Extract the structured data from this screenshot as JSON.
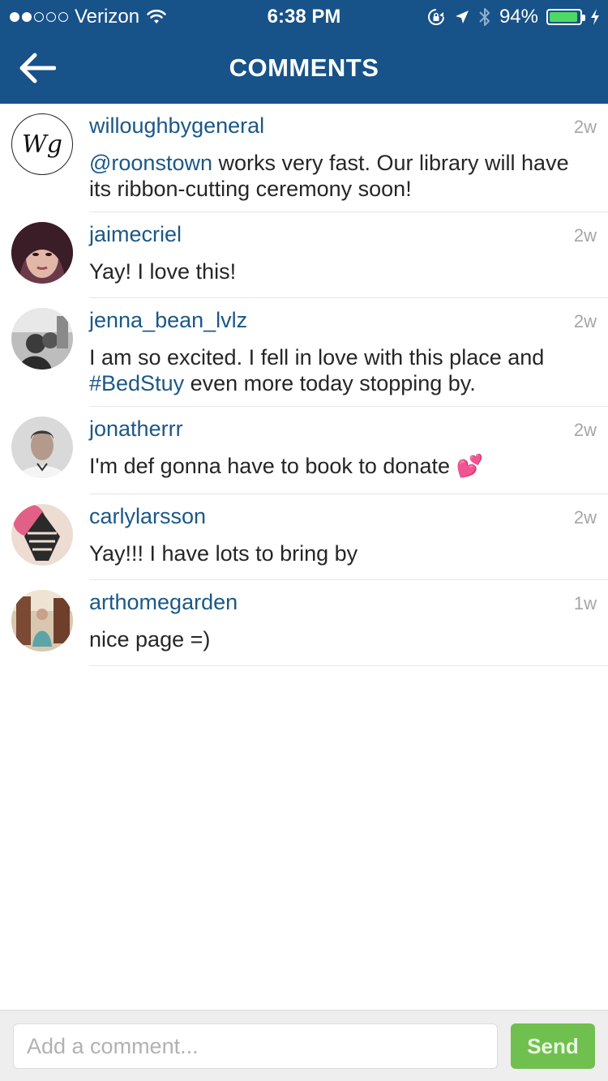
{
  "status_bar": {
    "carrier": "Verizon",
    "time": "6:38 PM",
    "battery": "94%",
    "battery_level": 0.94,
    "icons": [
      "signal-dots-icon",
      "wifi-icon",
      "rotation-lock-icon",
      "location-arrow-icon",
      "bluetooth-icon",
      "battery-icon",
      "charging-bolt-icon"
    ]
  },
  "nav": {
    "title": "COMMENTS",
    "back_icon": "back-arrow-icon",
    "bg_color": "#175289"
  },
  "comments": [
    {
      "username": "willoughbygeneral",
      "time": "2w",
      "mention": "@roonstown",
      "text": " works very fast. Our library will have its ribbon-cutting ceremony soon!",
      "avatar_text": "Wg"
    },
    {
      "username": "jaimecriel",
      "time": "2w",
      "mention": "",
      "text": "Yay! I love this!"
    },
    {
      "username": "jenna_bean_lvlz",
      "time": "2w",
      "text_before": "I am so excited. I fell in love with this place and ",
      "hashtag": "#BedStuy",
      "text_after": " even more today stopping by."
    },
    {
      "username": "jonatherrr",
      "time": "2w",
      "mention": "",
      "text": "I'm def gonna have to book to donate ",
      "emoji": "💕"
    },
    {
      "username": "carlylarsson",
      "time": "2w",
      "mention": "",
      "text": "Yay!!! I have lots to bring by"
    },
    {
      "username": "arthomegarden",
      "time": "1w",
      "mention": "",
      "text": "nice page =)"
    }
  ],
  "input": {
    "placeholder": "Add a comment...",
    "value": "",
    "send_label": "Send"
  },
  "colors": {
    "accent": "#175289",
    "username": "#1b5887",
    "send": "#70c050"
  }
}
